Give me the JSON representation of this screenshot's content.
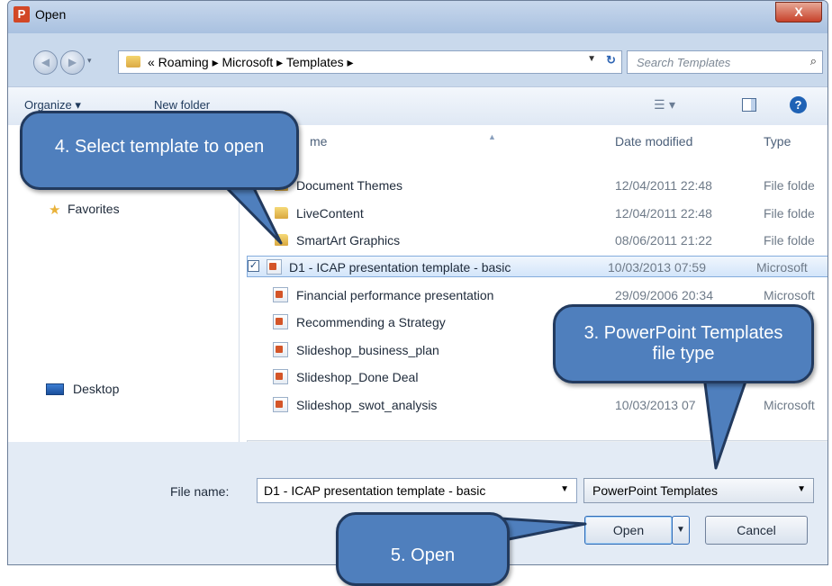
{
  "window": {
    "title": "Open",
    "app_icon": "powerpoint-icon",
    "close_label": "X"
  },
  "address_bar": {
    "crumbs": "« Roaming ▸ Microsoft ▸ Templates ▸",
    "search_placeholder": "Search Templates"
  },
  "toolbar": {
    "organize_label": "Organize ▾",
    "new_folder_label": "New folder"
  },
  "nav_pane": {
    "items": [
      {
        "label": "Favorites",
        "icon": "star-icon"
      },
      {
        "label": "Desktop",
        "icon": "desktop-icon"
      }
    ]
  },
  "columns": {
    "name": "Name",
    "name_visible": "me",
    "date": "Date modified",
    "type": "Type"
  },
  "files": [
    {
      "name": "Document Themes",
      "date": "12/04/2011 22:48",
      "type": "File folde",
      "kind": "folder"
    },
    {
      "name": "LiveContent",
      "date": "12/04/2011 22:48",
      "type": "File folde",
      "kind": "folder"
    },
    {
      "name": "SmartArt Graphics",
      "date": "08/06/2011 21:22",
      "type": "File folde",
      "kind": "folder"
    },
    {
      "name": "D1 - ICAP presentation template - basic",
      "date": "10/03/2013 07:59",
      "type": "Microsoft",
      "kind": "ppt",
      "selected": true,
      "checked": "✓"
    },
    {
      "name": "Financial performance presentation",
      "date": "29/09/2006 20:34",
      "type": "Microsoft",
      "kind": "ppt"
    },
    {
      "name": "Recommending a Strategy",
      "date": "",
      "type": "",
      "kind": "ppt"
    },
    {
      "name": "Slideshop_business_plan",
      "date": "",
      "type": "",
      "kind": "ppt"
    },
    {
      "name": "Slideshop_Done Deal",
      "date": "",
      "type": "",
      "kind": "ppt"
    },
    {
      "name": "Slideshop_swot_analysis",
      "date": "10/03/2013 07",
      "type": "Microsoft",
      "kind": "ppt"
    }
  ],
  "bottom": {
    "file_name_label": "File name:",
    "file_name_value": "D1 - ICAP presentation template - basic",
    "file_type_value": "PowerPoint Templates",
    "open_label": "Open",
    "cancel_label": "Cancel"
  },
  "callouts": {
    "select": "4. Select template to open",
    "filetype": "3. PowerPoint Templates file type",
    "open": "5. Open"
  },
  "colors": {
    "callout_fill": "#4f7fbd",
    "callout_border": "#223a5e",
    "selection": "#d3e5fa"
  }
}
